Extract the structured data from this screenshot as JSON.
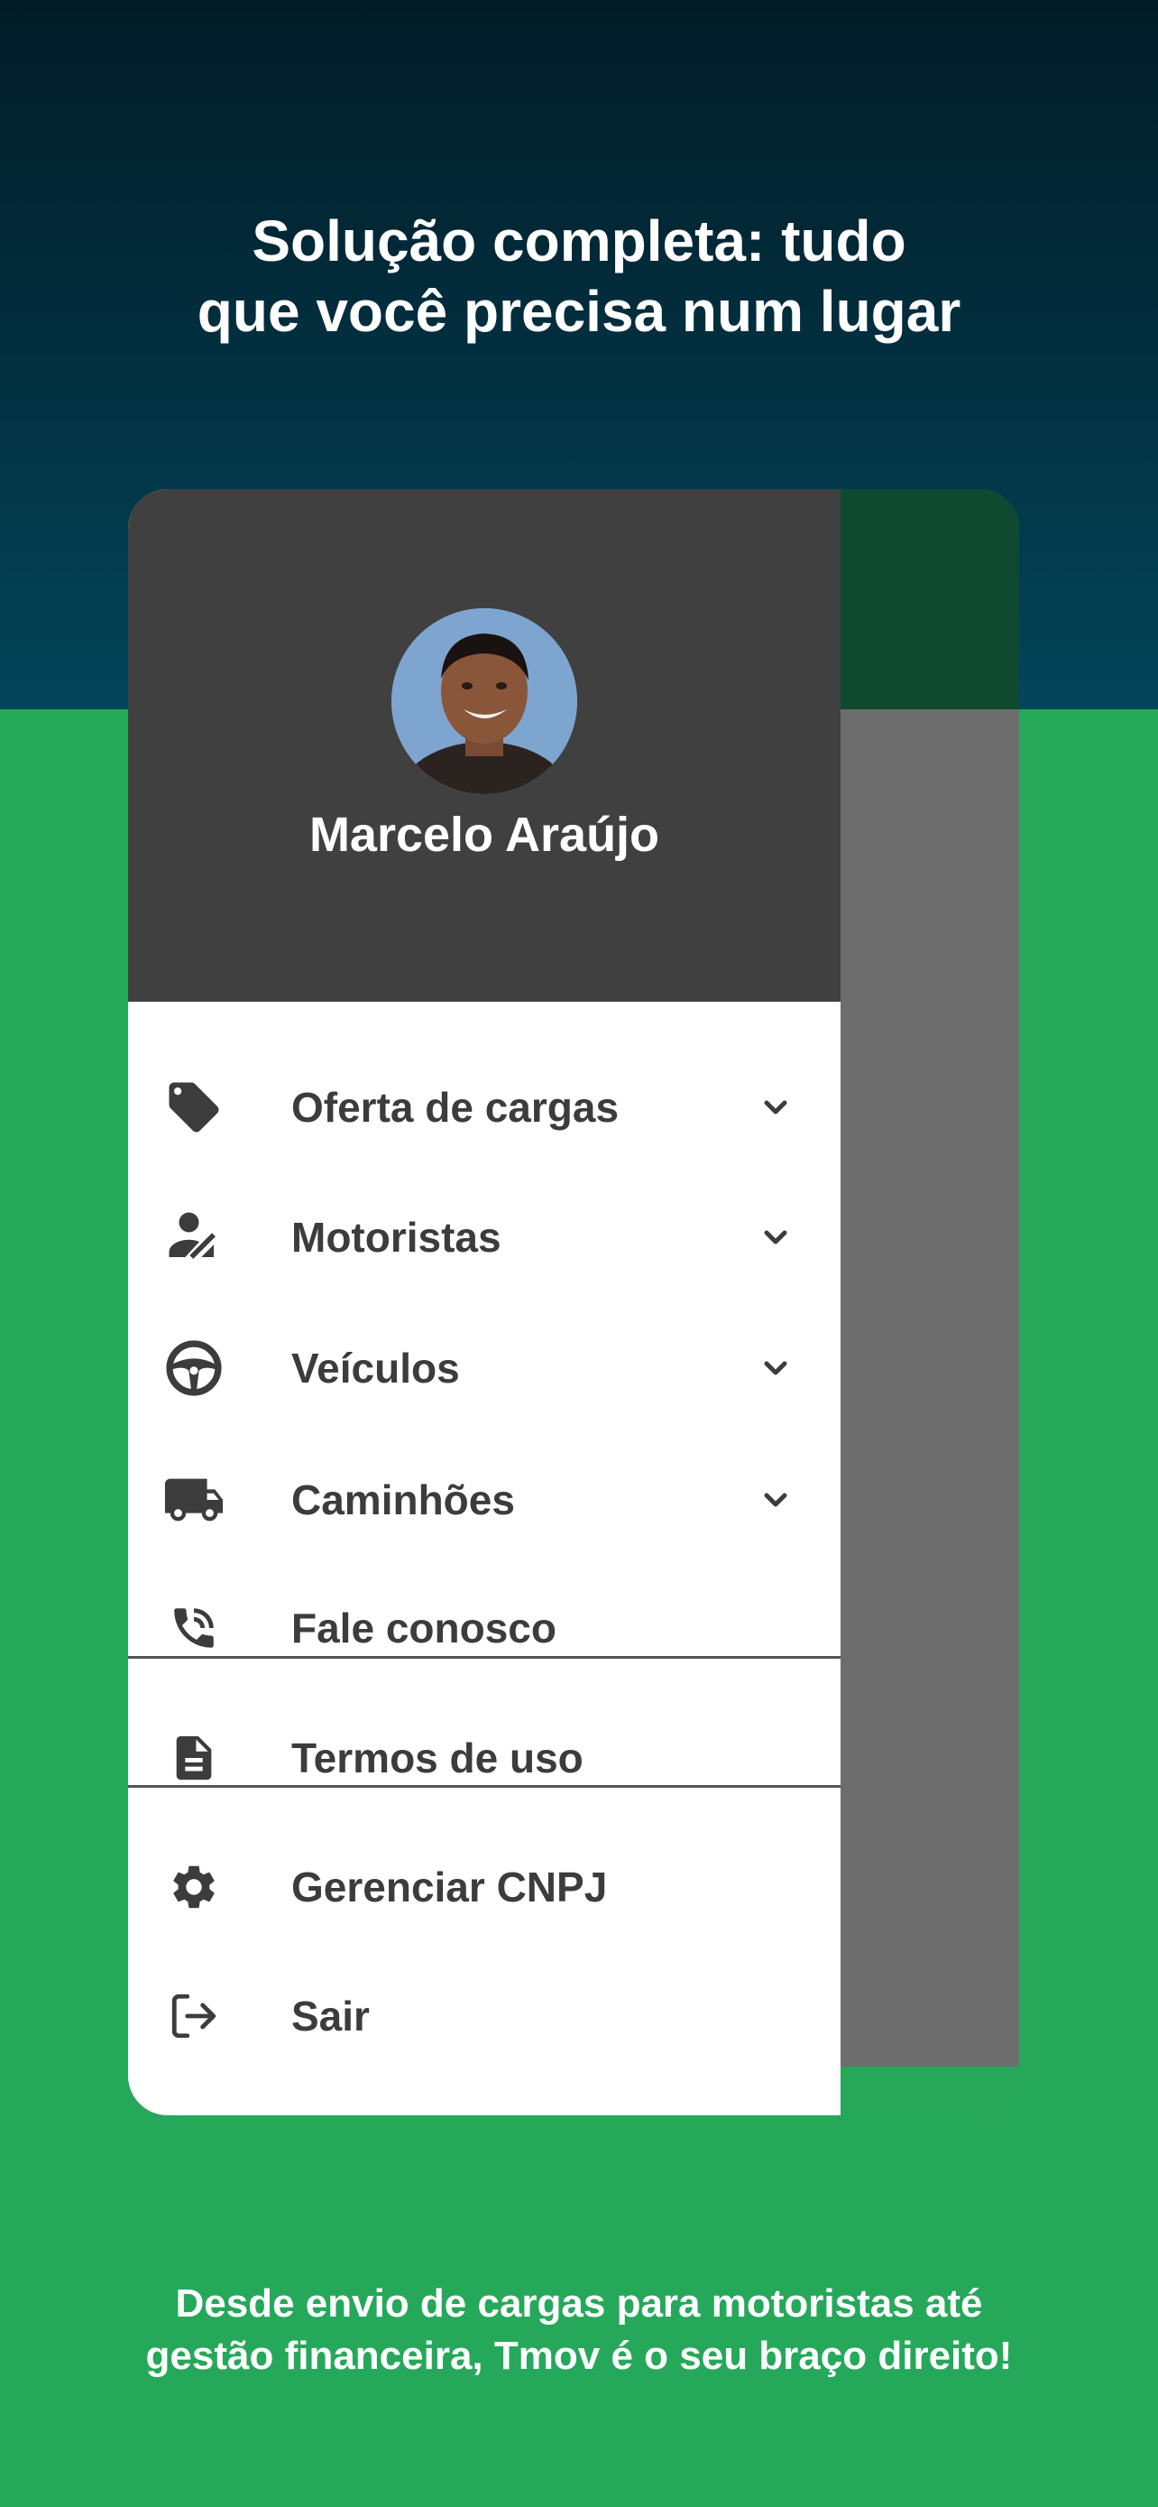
{
  "headline": "Solução completa: tudo\nque você precisa num lugar",
  "profile": {
    "name": "Marcelo Araújo"
  },
  "menu": [
    {
      "label": "Oferta de cargas",
      "icon": "tag-icon",
      "expandable": true
    },
    {
      "label": "Motoristas",
      "icon": "driver-icon",
      "expandable": true
    },
    {
      "label": "Veículos",
      "icon": "steering-wheel-icon",
      "expandable": true
    },
    {
      "label": "Caminhões",
      "icon": "truck-icon",
      "expandable": true
    },
    {
      "label": "Fale conosco",
      "icon": "phone-in-talk-icon",
      "expandable": false
    },
    {
      "label": "Termos de uso",
      "icon": "document-icon",
      "expandable": false
    },
    {
      "label": "Gerenciar CNPJ",
      "icon": "gear-icon",
      "expandable": false
    },
    {
      "label": "Sair",
      "icon": "logout-icon",
      "expandable": false
    }
  ],
  "subtitle": "Desde envio de cargas para motoristas até\ngestão financeira, Tmov é o seu braço direito!",
  "colors": {
    "top_background": "#022b3a",
    "bottom_background": "#25a85a",
    "drawer_header": "#404040",
    "scrim": "#6d6d6d",
    "menu_text": "#3c3c3c"
  }
}
